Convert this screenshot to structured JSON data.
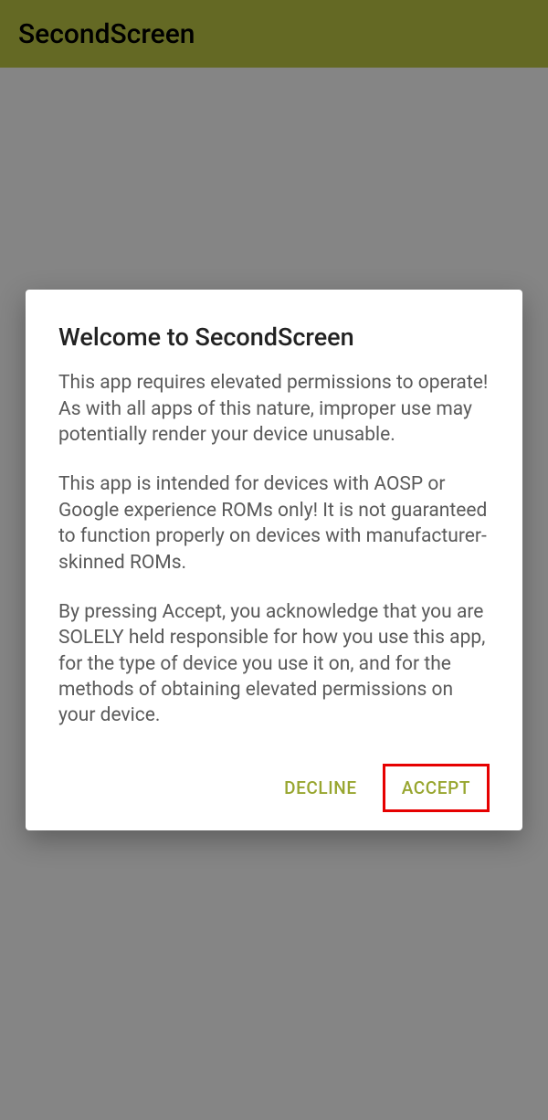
{
  "appbar": {
    "title": "SecondScreen"
  },
  "dialog": {
    "title": "Welcome to SecondScreen",
    "para1": "This app requires elevated permissions to operate! As with all apps of this nature, improper use may potentially render your device unusable.",
    "para2": "This app is intended for devices with AOSP or Google experience ROMs only! It is not guaranteed to function properly on devices with manufacturer-skinned ROMs.",
    "para3": "By pressing Accept, you acknowledge that you are SOLELY held responsible for how you use this app, for the type of device you use it on, and for the methods of obtaining elevated permissions on your device.",
    "decline_label": "DECLINE",
    "accept_label": "ACCEPT"
  }
}
